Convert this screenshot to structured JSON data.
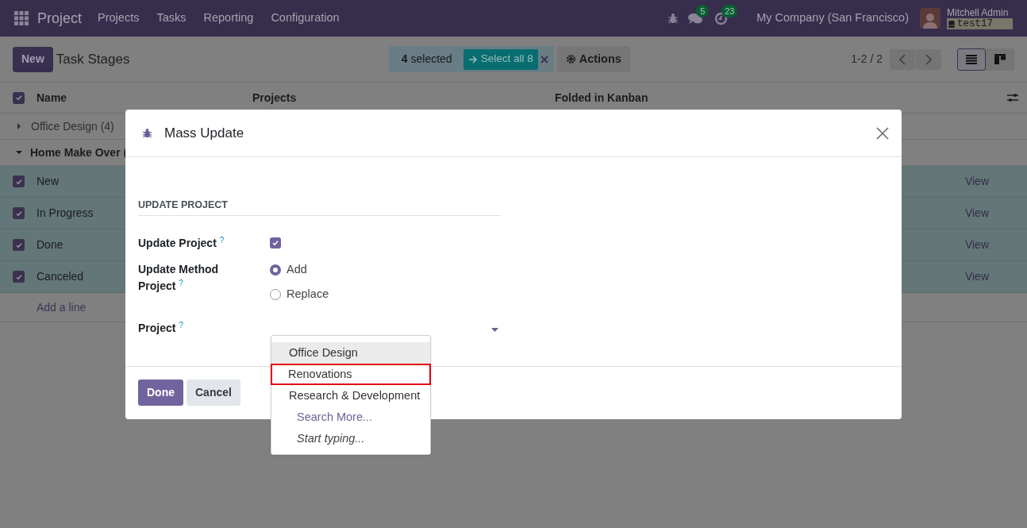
{
  "navbar": {
    "app": "Project",
    "menu": [
      "Projects",
      "Tasks",
      "Reporting",
      "Configuration"
    ],
    "messages_count": "5",
    "activities_count": "23",
    "company": "My Company (San Francisco)",
    "user": "Mitchell Admin",
    "database": "test17"
  },
  "control_panel": {
    "new_button": "New",
    "title": "Task Stages",
    "selection": "**4** selected",
    "select_all": "Select all 8",
    "actions": "Actions",
    "pager": "1-2 / 2",
    "views": [
      {
        "kind": "list",
        "selected": true
      },
      {
        "kind": "kanban",
        "selected": false
      }
    ]
  },
  "table": {
    "all_checked": true,
    "columns": [
      "Name",
      "Projects",
      "Folded in Kanban"
    ],
    "groups": [
      {
        "label": "Office Design (4)",
        "expanded": false
      },
      {
        "label": "Home Make Over (",
        "expanded": true,
        "rows": [
          {
            "name": "New",
            "checked": true,
            "action": "View"
          },
          {
            "name": "In Progress",
            "checked": true,
            "action": "View"
          },
          {
            "name": "Done",
            "checked": true,
            "action": "View"
          },
          {
            "name": "Canceled",
            "checked": true,
            "action": "View"
          }
        ]
      }
    ],
    "add_line": "Add a line"
  },
  "dialog": {
    "title": "Mass Update",
    "section": "UPDATE PROJECT",
    "update_field": {
      "label": "Update Project",
      "help": "?",
      "checked": true
    },
    "method_field": {
      "label": "Update Method Project",
      "help": "?",
      "options": [
        {
          "label": "Add",
          "selected": true
        },
        {
          "label": "Replace",
          "selected": false
        }
      ]
    },
    "project_field": {
      "label": "Project",
      "help": "?"
    },
    "dropdown": [
      {
        "kind": "option",
        "label": "Office Design",
        "highlighted": true,
        "outlined": false
      },
      {
        "kind": "option",
        "label": "Renovations",
        "highlighted": false,
        "outlined": true
      },
      {
        "kind": "option",
        "label": "Research & Development",
        "highlighted": false,
        "outlined": false
      },
      {
        "kind": "link",
        "label": "Search More...",
        "highlighted": false,
        "outlined": false
      },
      {
        "kind": "hint",
        "label": "Start typing...",
        "highlighted": false,
        "outlined": false
      }
    ],
    "buttons": [
      {
        "kind": "primary",
        "label": "Done"
      },
      {
        "kind": "secondary",
        "label": "Cancel"
      }
    ]
  }
}
